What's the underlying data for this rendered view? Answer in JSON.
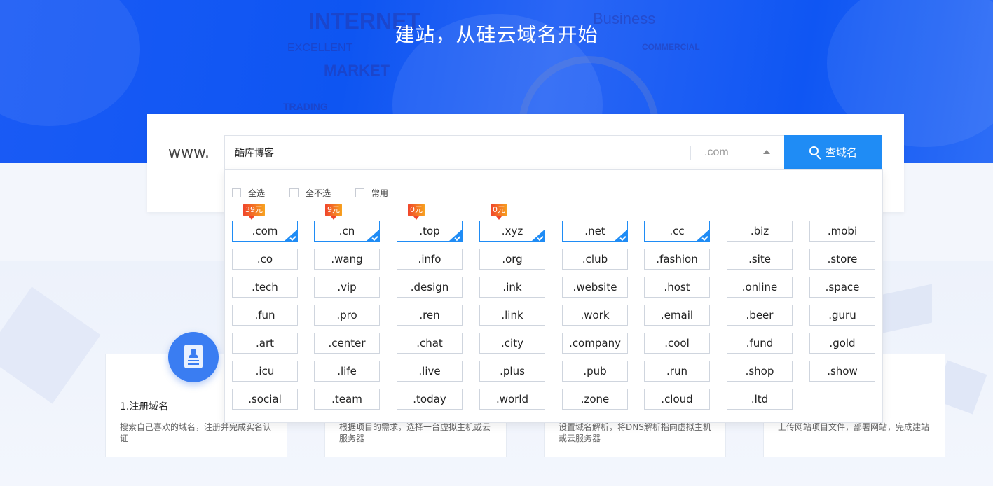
{
  "hero": {
    "title": "建站，从硅云域名开始",
    "deco_words": [
      "INTERNET",
      "EXCELLENT",
      "MARKET",
      "TRADING",
      "Business",
      "COMMERCIAL"
    ]
  },
  "search": {
    "prefix": "www.",
    "query": "酷库博客",
    "suffix_value": ".com",
    "button_label": "查域名"
  },
  "options": [
    "全选",
    "全不选",
    "常用"
  ],
  "suffixes": [
    {
      "name": ".com",
      "selected": true,
      "price": "39元"
    },
    {
      "name": ".cn",
      "selected": true,
      "price": "9元"
    },
    {
      "name": ".top",
      "selected": true,
      "price": "0元"
    },
    {
      "name": ".xyz",
      "selected": true,
      "price": "0元"
    },
    {
      "name": ".net",
      "selected": true
    },
    {
      "name": ".cc",
      "selected": true
    },
    {
      "name": ".biz"
    },
    {
      "name": ".mobi"
    },
    {
      "name": ".co"
    },
    {
      "name": ".wang"
    },
    {
      "name": ".info"
    },
    {
      "name": ".org"
    },
    {
      "name": ".club"
    },
    {
      "name": ".fashion"
    },
    {
      "name": ".site"
    },
    {
      "name": ".store"
    },
    {
      "name": ".tech"
    },
    {
      "name": ".vip"
    },
    {
      "name": ".design"
    },
    {
      "name": ".ink"
    },
    {
      "name": ".website"
    },
    {
      "name": ".host"
    },
    {
      "name": ".online"
    },
    {
      "name": ".space"
    },
    {
      "name": ".fun"
    },
    {
      "name": ".pro"
    },
    {
      "name": ".ren"
    },
    {
      "name": ".link"
    },
    {
      "name": ".work"
    },
    {
      "name": ".email"
    },
    {
      "name": ".beer"
    },
    {
      "name": ".guru"
    },
    {
      "name": ".art"
    },
    {
      "name": ".center"
    },
    {
      "name": ".chat"
    },
    {
      "name": ".city"
    },
    {
      "name": ".company"
    },
    {
      "name": ".cool"
    },
    {
      "name": ".fund"
    },
    {
      "name": ".gold"
    },
    {
      "name": ".icu"
    },
    {
      "name": ".life"
    },
    {
      "name": ".live"
    },
    {
      "name": ".plus"
    },
    {
      "name": ".pub"
    },
    {
      "name": ".run"
    },
    {
      "name": ".shop"
    },
    {
      "name": ".show"
    },
    {
      "name": ".social"
    },
    {
      "name": ".team"
    },
    {
      "name": ".today"
    },
    {
      "name": ".world"
    },
    {
      "name": ".zone"
    },
    {
      "name": ".cloud"
    },
    {
      "name": ".ltd"
    }
  ],
  "steps": [
    {
      "title": "1.注册域名",
      "desc": "搜索自己喜欢的域名，注册并完成实名认证"
    },
    {
      "title": "",
      "desc": "根据项目的需求，选择一台虚拟主机或云服务器"
    },
    {
      "title": "",
      "desc": "设置域名解析，将DNS解析指向虚拟主机或云服务器"
    },
    {
      "title": "",
      "desc": "上传网站项目文件，部署网站，完成建站"
    }
  ]
}
